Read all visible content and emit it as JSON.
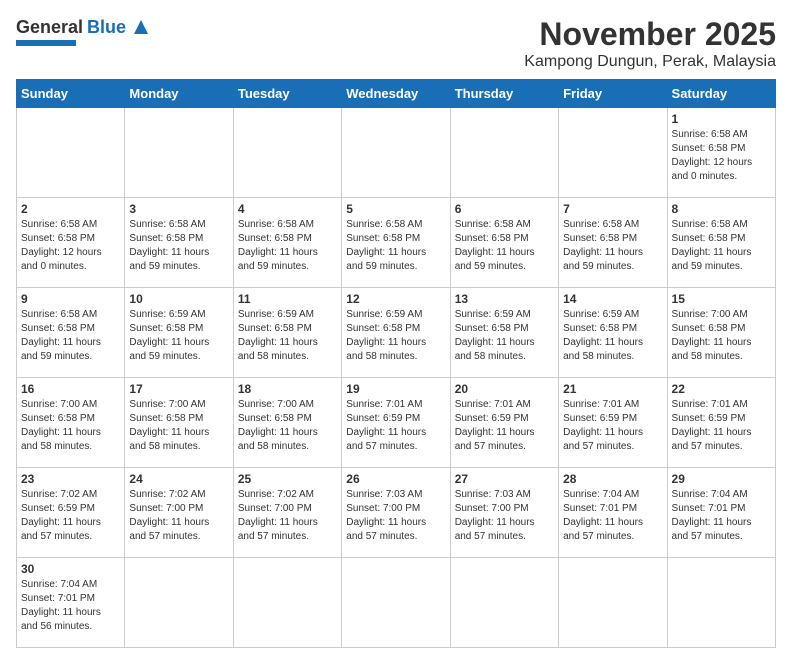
{
  "header": {
    "logo_general": "General",
    "logo_blue": "Blue",
    "month_title": "November 2025",
    "location": "Kampong Dungun, Perak, Malaysia"
  },
  "days_of_week": [
    "Sunday",
    "Monday",
    "Tuesday",
    "Wednesday",
    "Thursday",
    "Friday",
    "Saturday"
  ],
  "weeks": [
    [
      {
        "day": "",
        "info": ""
      },
      {
        "day": "",
        "info": ""
      },
      {
        "day": "",
        "info": ""
      },
      {
        "day": "",
        "info": ""
      },
      {
        "day": "",
        "info": ""
      },
      {
        "day": "",
        "info": ""
      },
      {
        "day": "1",
        "info": "Sunrise: 6:58 AM\nSunset: 6:58 PM\nDaylight: 12 hours\nand 0 minutes."
      }
    ],
    [
      {
        "day": "2",
        "info": "Sunrise: 6:58 AM\nSunset: 6:58 PM\nDaylight: 12 hours\nand 0 minutes."
      },
      {
        "day": "3",
        "info": "Sunrise: 6:58 AM\nSunset: 6:58 PM\nDaylight: 11 hours\nand 59 minutes."
      },
      {
        "day": "4",
        "info": "Sunrise: 6:58 AM\nSunset: 6:58 PM\nDaylight: 11 hours\nand 59 minutes."
      },
      {
        "day": "5",
        "info": "Sunrise: 6:58 AM\nSunset: 6:58 PM\nDaylight: 11 hours\nand 59 minutes."
      },
      {
        "day": "6",
        "info": "Sunrise: 6:58 AM\nSunset: 6:58 PM\nDaylight: 11 hours\nand 59 minutes."
      },
      {
        "day": "7",
        "info": "Sunrise: 6:58 AM\nSunset: 6:58 PM\nDaylight: 11 hours\nand 59 minutes."
      },
      {
        "day": "8",
        "info": "Sunrise: 6:58 AM\nSunset: 6:58 PM\nDaylight: 11 hours\nand 59 minutes."
      }
    ],
    [
      {
        "day": "9",
        "info": "Sunrise: 6:58 AM\nSunset: 6:58 PM\nDaylight: 11 hours\nand 59 minutes."
      },
      {
        "day": "10",
        "info": "Sunrise: 6:59 AM\nSunset: 6:58 PM\nDaylight: 11 hours\nand 59 minutes."
      },
      {
        "day": "11",
        "info": "Sunrise: 6:59 AM\nSunset: 6:58 PM\nDaylight: 11 hours\nand 58 minutes."
      },
      {
        "day": "12",
        "info": "Sunrise: 6:59 AM\nSunset: 6:58 PM\nDaylight: 11 hours\nand 58 minutes."
      },
      {
        "day": "13",
        "info": "Sunrise: 6:59 AM\nSunset: 6:58 PM\nDaylight: 11 hours\nand 58 minutes."
      },
      {
        "day": "14",
        "info": "Sunrise: 6:59 AM\nSunset: 6:58 PM\nDaylight: 11 hours\nand 58 minutes."
      },
      {
        "day": "15",
        "info": "Sunrise: 7:00 AM\nSunset: 6:58 PM\nDaylight: 11 hours\nand 58 minutes."
      }
    ],
    [
      {
        "day": "16",
        "info": "Sunrise: 7:00 AM\nSunset: 6:58 PM\nDaylight: 11 hours\nand 58 minutes."
      },
      {
        "day": "17",
        "info": "Sunrise: 7:00 AM\nSunset: 6:58 PM\nDaylight: 11 hours\nand 58 minutes."
      },
      {
        "day": "18",
        "info": "Sunrise: 7:00 AM\nSunset: 6:58 PM\nDaylight: 11 hours\nand 58 minutes."
      },
      {
        "day": "19",
        "info": "Sunrise: 7:01 AM\nSunset: 6:59 PM\nDaylight: 11 hours\nand 57 minutes."
      },
      {
        "day": "20",
        "info": "Sunrise: 7:01 AM\nSunset: 6:59 PM\nDaylight: 11 hours\nand 57 minutes."
      },
      {
        "day": "21",
        "info": "Sunrise: 7:01 AM\nSunset: 6:59 PM\nDaylight: 11 hours\nand 57 minutes."
      },
      {
        "day": "22",
        "info": "Sunrise: 7:01 AM\nSunset: 6:59 PM\nDaylight: 11 hours\nand 57 minutes."
      }
    ],
    [
      {
        "day": "23",
        "info": "Sunrise: 7:02 AM\nSunset: 6:59 PM\nDaylight: 11 hours\nand 57 minutes."
      },
      {
        "day": "24",
        "info": "Sunrise: 7:02 AM\nSunset: 7:00 PM\nDaylight: 11 hours\nand 57 minutes."
      },
      {
        "day": "25",
        "info": "Sunrise: 7:02 AM\nSunset: 7:00 PM\nDaylight: 11 hours\nand 57 minutes."
      },
      {
        "day": "26",
        "info": "Sunrise: 7:03 AM\nSunset: 7:00 PM\nDaylight: 11 hours\nand 57 minutes."
      },
      {
        "day": "27",
        "info": "Sunrise: 7:03 AM\nSunset: 7:00 PM\nDaylight: 11 hours\nand 57 minutes."
      },
      {
        "day": "28",
        "info": "Sunrise: 7:04 AM\nSunset: 7:01 PM\nDaylight: 11 hours\nand 57 minutes."
      },
      {
        "day": "29",
        "info": "Sunrise: 7:04 AM\nSunset: 7:01 PM\nDaylight: 11 hours\nand 57 minutes."
      }
    ],
    [
      {
        "day": "30",
        "info": "Sunrise: 7:04 AM\nSunset: 7:01 PM\nDaylight: 11 hours\nand 56 minutes."
      },
      {
        "day": "",
        "info": ""
      },
      {
        "day": "",
        "info": ""
      },
      {
        "day": "",
        "info": ""
      },
      {
        "day": "",
        "info": ""
      },
      {
        "day": "",
        "info": ""
      },
      {
        "day": "",
        "info": ""
      }
    ]
  ]
}
